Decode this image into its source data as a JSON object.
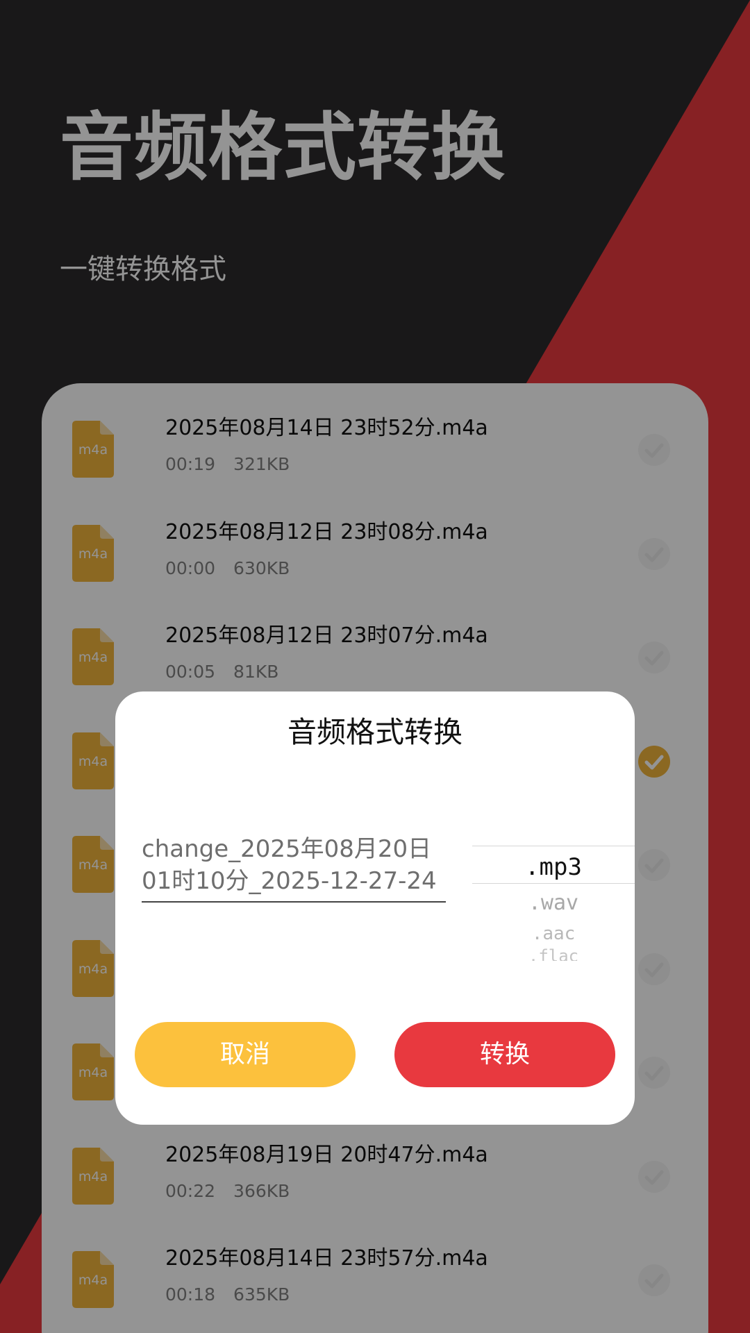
{
  "header": {
    "title": "音频格式转换",
    "subtitle": "一键转换格式"
  },
  "colors": {
    "background_dark": "#2b2a2c",
    "accent_red": "#e8393f",
    "accent_yellow": "#fcc13d",
    "file_icon": "#f0b43c"
  },
  "files": [
    {
      "name": "2025年08月14日 23时52分.m4a",
      "duration": "00:19",
      "size": "321KB",
      "ext": "m4a",
      "checked": false
    },
    {
      "name": "2025年08月12日 23时08分.m4a",
      "duration": "00:00",
      "size": "630KB",
      "ext": "m4a",
      "checked": false
    },
    {
      "name": "2025年08月12日 23时07分.m4a",
      "duration": "00:05",
      "size": "81KB",
      "ext": "m4a",
      "checked": false
    },
    {
      "name": "",
      "duration": "",
      "size": "",
      "ext": "m4a",
      "checked": true
    },
    {
      "name": "",
      "duration": "",
      "size": "",
      "ext": "m4a",
      "checked": false
    },
    {
      "name": "",
      "duration": "",
      "size": "",
      "ext": "m4a",
      "checked": false
    },
    {
      "name": "",
      "duration": "",
      "size": "",
      "ext": "m4a",
      "checked": false
    },
    {
      "name": "2025年08月19日 20时47分.m4a",
      "duration": "00:22",
      "size": "366KB",
      "ext": "m4a",
      "checked": false
    },
    {
      "name": "2025年08月14日 23时57分.m4a",
      "duration": "00:18",
      "size": "635KB",
      "ext": "m4a",
      "checked": false
    }
  ],
  "dialog": {
    "title": "音频格式转换",
    "filename": "change_2025年08月20日01时10分_2025-12-27-24",
    "formats": [
      ".mp3",
      ".wav",
      ".aac",
      ".flac"
    ],
    "selected_format": ".mp3",
    "cancel_label": "取消",
    "convert_label": "转换"
  }
}
